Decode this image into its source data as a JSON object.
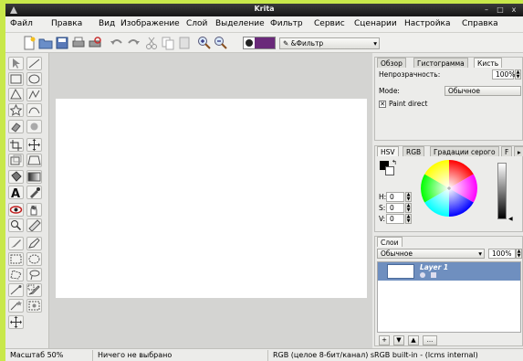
{
  "window": {
    "title": "Krita",
    "minimize_label": "–",
    "maximize_label": "□",
    "close_label": "x"
  },
  "menu": {
    "items": [
      {
        "label": "Файл"
      },
      {
        "label": "Правка"
      },
      {
        "label": "Вид"
      },
      {
        "label": "Изображение"
      },
      {
        "label": "Слой"
      },
      {
        "label": "Выделение"
      },
      {
        "label": "Фильтр"
      },
      {
        "label": "Сервис"
      },
      {
        "label": "Сценарии"
      },
      {
        "label": "Настройка"
      },
      {
        "label": "Справка"
      }
    ]
  },
  "toolbar": {
    "filter_label": "&Фильтр",
    "color_swatch": "#6a2a7a"
  },
  "brush_panel": {
    "tabs": [
      {
        "label": "Обзор"
      },
      {
        "label": "Гистограмма"
      },
      {
        "label": "Кисть"
      }
    ],
    "opacity_label": "Непрозрачность:",
    "opacity_value": "100%",
    "mode_label": "Mode:",
    "mode_value": "Обычное",
    "paint_direct_label": "Paint direct"
  },
  "color_panel": {
    "tabs": [
      {
        "label": "HSV"
      },
      {
        "label": "RGB"
      },
      {
        "label": "Градации серого"
      },
      {
        "label": "F"
      }
    ],
    "h_label": "H:",
    "h_value": "0",
    "s_label": "S:",
    "s_value": "0",
    "v_label": "V:",
    "v_value": "0",
    "foreground_color": "#000000",
    "background_color": "#ffffff"
  },
  "layers_panel": {
    "tab_label": "Слои",
    "blend_mode": "Обычное",
    "opacity_value": "100%",
    "layers": [
      {
        "name": "Layer 1"
      }
    ],
    "add_button": "+",
    "down_button": "▼",
    "up_button": "▲",
    "more_button": "..."
  },
  "status": {
    "zoom": "Масштаб 50%",
    "selection": "Ничего не выбрано",
    "color_model": "RGB (целое 8-бит/канал)  sRGB built-in - (lcms internal)"
  }
}
